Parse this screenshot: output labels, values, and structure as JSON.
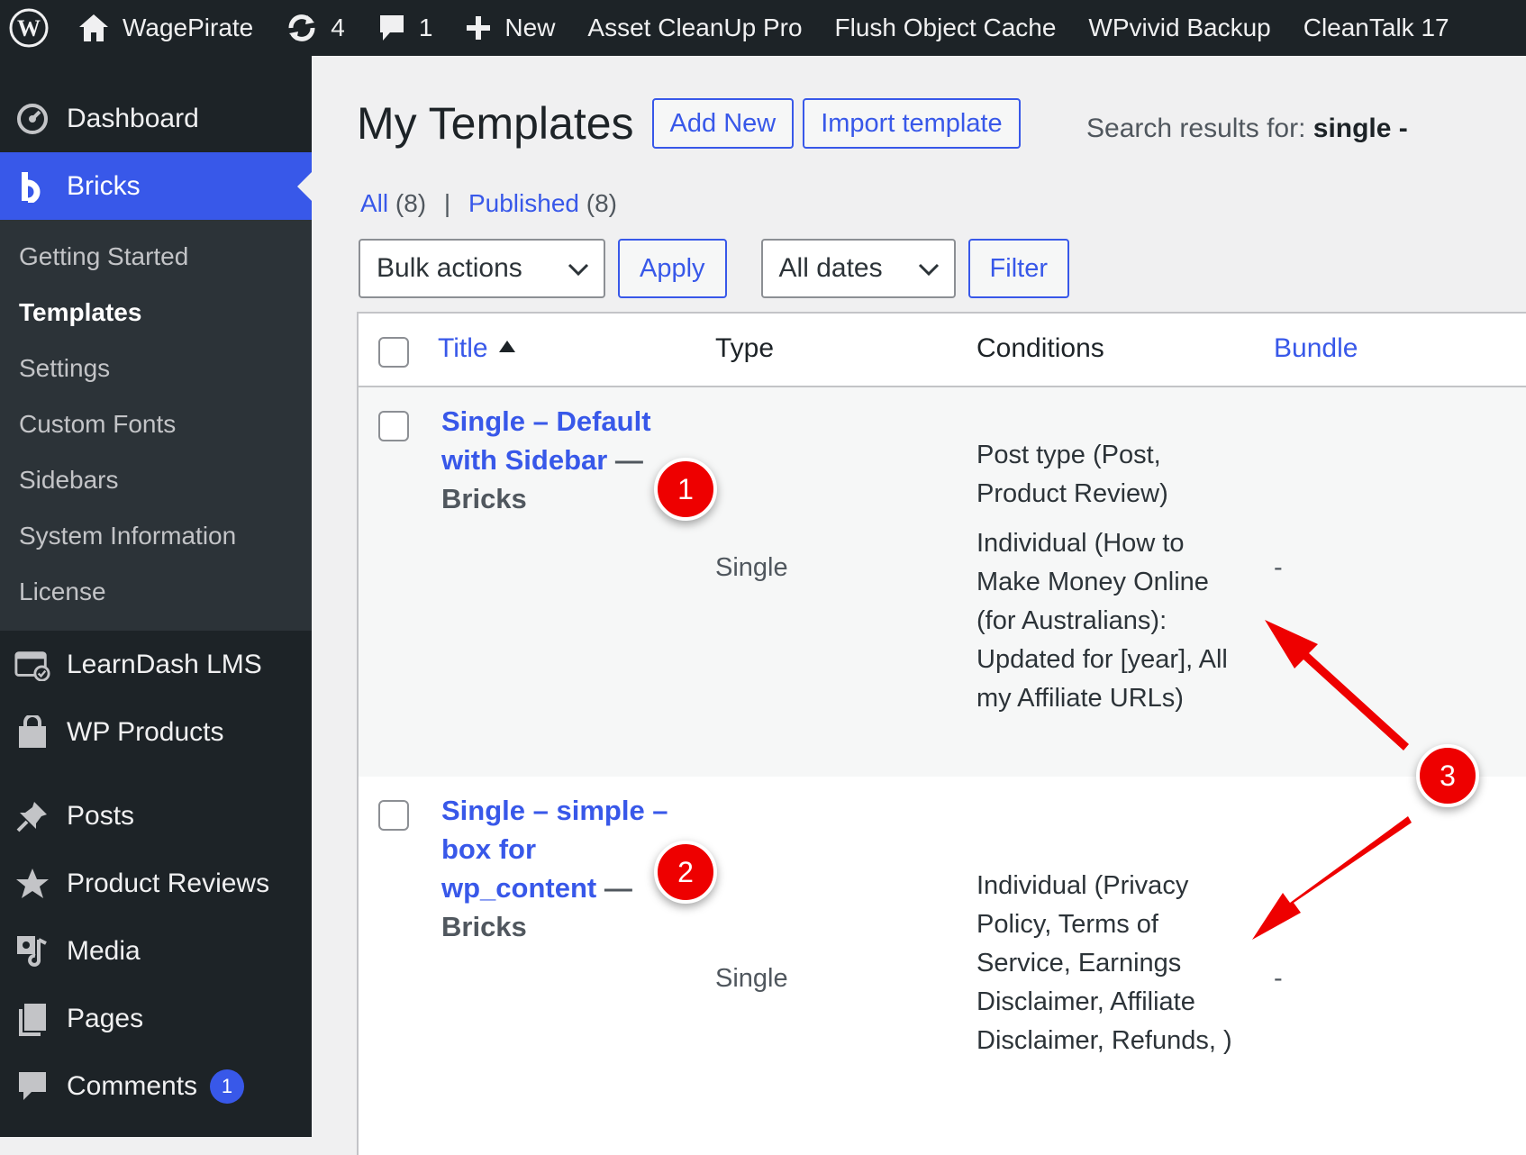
{
  "adminbar": {
    "site_name": "WagePirate",
    "updates_count": "4",
    "comments_count": "1",
    "new_label": "New",
    "items": [
      "Asset CleanUp Pro",
      "Flush Object Cache",
      "WPvivid Backup",
      "CleanTalk 17"
    ]
  },
  "sidebar": {
    "dashboard": "Dashboard",
    "bricks": "Bricks",
    "submenu": [
      "Getting Started",
      "Templates",
      "Settings",
      "Custom Fonts",
      "Sidebars",
      "System Information",
      "License"
    ],
    "learndash": "LearnDash LMS",
    "wp_products": "WP Products",
    "posts": "Posts",
    "product_reviews": "Product Reviews",
    "media": "Media",
    "pages": "Pages",
    "comments": "Comments",
    "comments_badge": "1"
  },
  "page": {
    "title": "My Templates",
    "add_new": "Add New",
    "import_template": "Import template",
    "search_prefix": "Search results for: ",
    "search_term": "single",
    "search_suffix": " -"
  },
  "views": {
    "all_label": "All",
    "all_count": "(8)",
    "separator": "|",
    "published_label": "Published",
    "published_count": "(8)"
  },
  "tablenav": {
    "bulk_actions": "Bulk actions",
    "apply": "Apply",
    "all_dates": "All dates",
    "filter": "Filter"
  },
  "table": {
    "columns": {
      "title": "Title",
      "type": "Type",
      "conditions": "Conditions",
      "bundle": "Bundle"
    },
    "rows": [
      {
        "title_lines": [
          "Single – Default",
          "with Sidebar"
        ],
        "dash": " —",
        "suffix": "Bricks",
        "type": "Single",
        "conditions": [
          "Post type (Post, Product Review)",
          "Individual (How to Make Money Online (for Australians): Updated for [year], All my Affiliate URLs)"
        ],
        "bundle": "-"
      },
      {
        "title_lines": [
          "Single – simple –",
          "box for",
          "wp_content"
        ],
        "dash": " —",
        "suffix": "Bricks",
        "type": "Single",
        "conditions": [
          "Individual (Privacy Policy, Terms of Service, Earnings Disclaimer, Affiliate Disclaimer, Refunds, )"
        ],
        "bundle": "-"
      }
    ]
  },
  "annotations": [
    "1",
    "2",
    "3"
  ],
  "colors": {
    "accent": "#3858e9",
    "adminbar": "#1d2327",
    "annotation": "#ee0000"
  }
}
